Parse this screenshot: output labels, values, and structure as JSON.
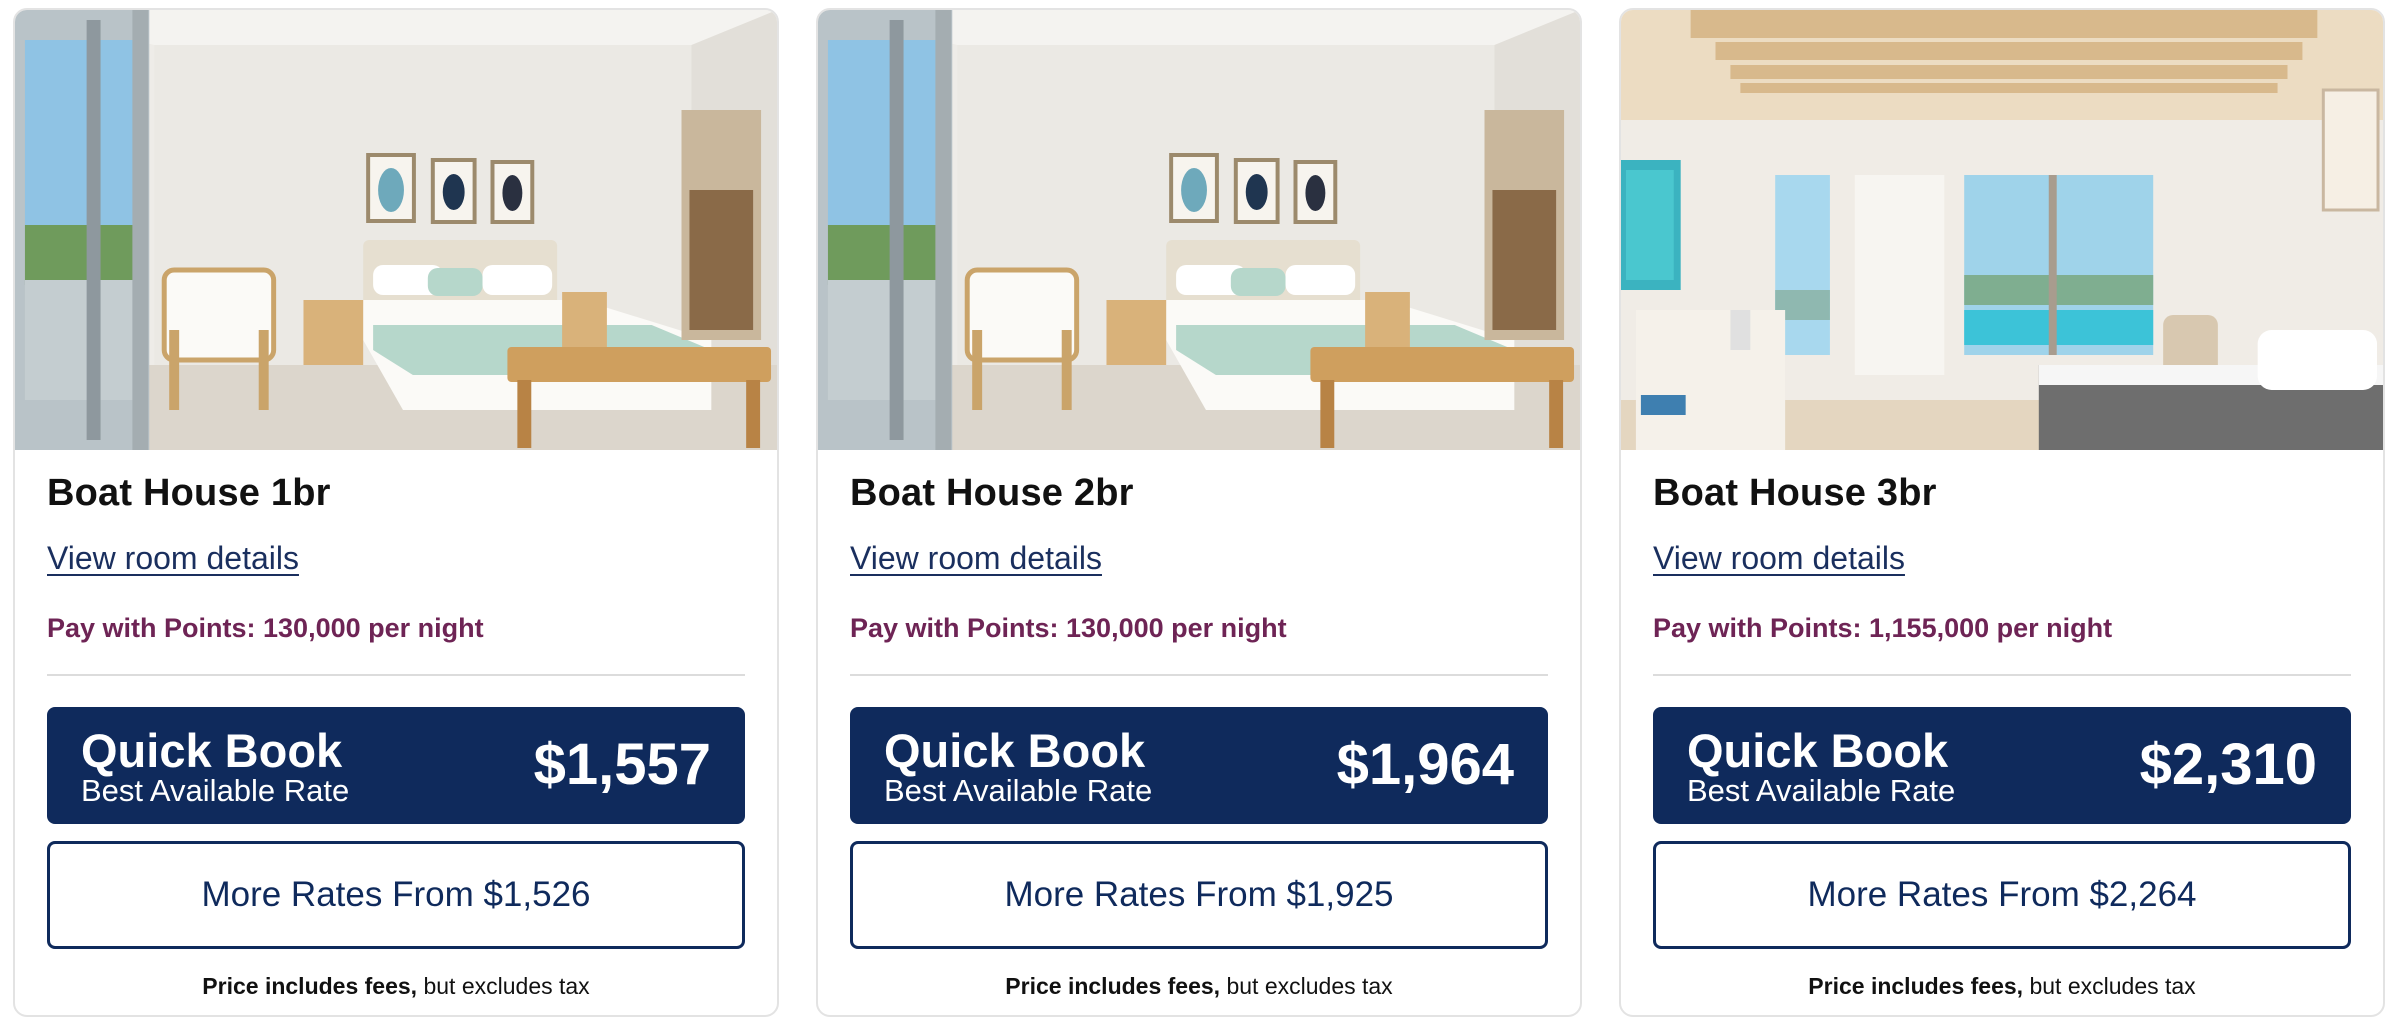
{
  "cards": [
    {
      "name": "Boat House 1br",
      "details_link": "View room details",
      "points": "Pay with Points: 130,000 per night",
      "quick_book_title": "Quick Book",
      "quick_book_subtitle": "Best Available Rate",
      "quick_book_price": "$1,557",
      "more_rates": "More Rates From $1,526",
      "fee_bold": "Price includes fees,",
      "fee_rest": " but excludes tax"
    },
    {
      "name": "Boat House 2br",
      "details_link": "View room details",
      "points": "Pay with Points: 130,000 per night",
      "quick_book_title": "Quick Book",
      "quick_book_subtitle": "Best Available Rate",
      "quick_book_price": "$1,964",
      "more_rates": "More Rates From $1,925",
      "fee_bold": "Price includes fees,",
      "fee_rest": " but excludes tax"
    },
    {
      "name": "Boat House 3br",
      "details_link": "View room details",
      "points": "Pay with Points: 1,155,000 per night",
      "quick_book_title": "Quick Book",
      "quick_book_subtitle": "Best Available Rate",
      "quick_book_price": "$2,310",
      "more_rates": "More Rates From $2,264",
      "fee_bold": "Price includes fees,",
      "fee_rest": " but excludes tax"
    }
  ],
  "colors": {
    "brand_navy": "#0f2a5c",
    "points_plum": "#6e2455",
    "link_navy": "#1a2f5e"
  }
}
